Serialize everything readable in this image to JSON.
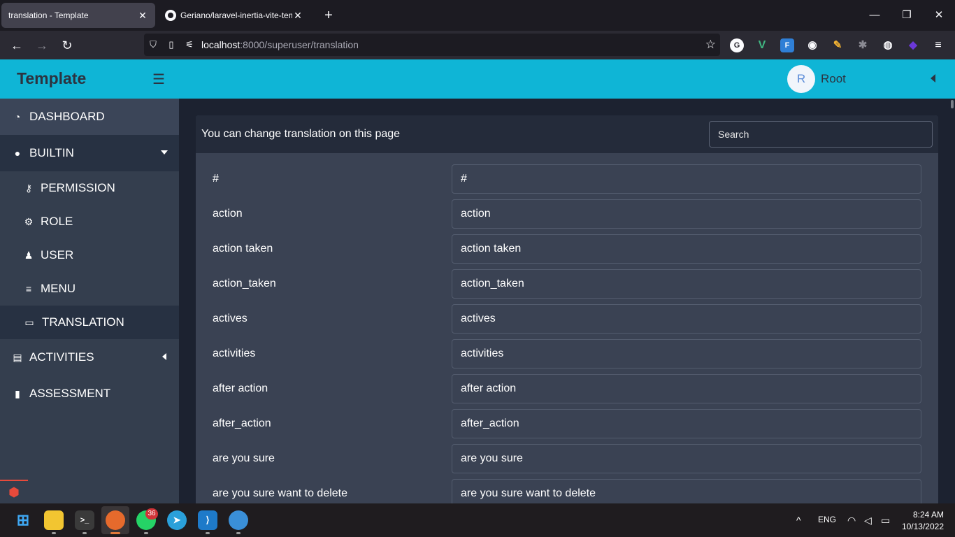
{
  "browser": {
    "tabs": [
      {
        "title": "translation - Template",
        "active": true
      },
      {
        "title": "Geriano/laravel-inertia-vite-tem",
        "active": false
      }
    ],
    "url_host": "localhost",
    "url_path": ":8000/superuser/translation",
    "extensions": [
      "G",
      "V",
      "F",
      "cookie",
      "bird",
      "bug",
      "globe",
      "gem"
    ]
  },
  "app": {
    "brand": "Template",
    "user": {
      "initial": "R",
      "name": "Root"
    }
  },
  "sidebar": {
    "items": [
      {
        "label": "DASHBOARD",
        "icon": "gauge-icon"
      },
      {
        "label": "BUILTIN",
        "icon": "circle-icon",
        "expanded": true
      },
      {
        "label": "PERMISSION",
        "icon": "key-icon"
      },
      {
        "label": "ROLE",
        "icon": "user-gear-icon"
      },
      {
        "label": "USER",
        "icon": "user-icon"
      },
      {
        "label": "MENU",
        "icon": "bars-icon"
      },
      {
        "label": "TRANSLATION",
        "icon": "language-icon",
        "active": true
      },
      {
        "label": "ACTIVITIES",
        "icon": "id-card-icon",
        "collapsed": true
      },
      {
        "label": "ASSESSMENT",
        "icon": "file-clock-icon"
      }
    ]
  },
  "main": {
    "title": "You can change translation on this page",
    "search_placeholder": "Search",
    "rows": [
      {
        "key": "#",
        "value": "#"
      },
      {
        "key": "action",
        "value": "action"
      },
      {
        "key": "action taken",
        "value": "action taken"
      },
      {
        "key": "action_taken",
        "value": "action_taken"
      },
      {
        "key": "actives",
        "value": "actives"
      },
      {
        "key": "activities",
        "value": "activities"
      },
      {
        "key": "after action",
        "value": "after action"
      },
      {
        "key": "after_action",
        "value": "after_action"
      },
      {
        "key": "are you sure",
        "value": "are you sure"
      },
      {
        "key": "are you sure want to delete",
        "value": "are you sure want to delete"
      }
    ]
  },
  "taskbar": {
    "whatsapp_badge": "36",
    "language": "ENG",
    "time": "8:24 AM",
    "date": "10/13/2022"
  },
  "colors": {
    "header": "#0fb5d6",
    "sidebar": "#343e4e",
    "card": "#3a4253",
    "page_bg": "#1c2230"
  }
}
